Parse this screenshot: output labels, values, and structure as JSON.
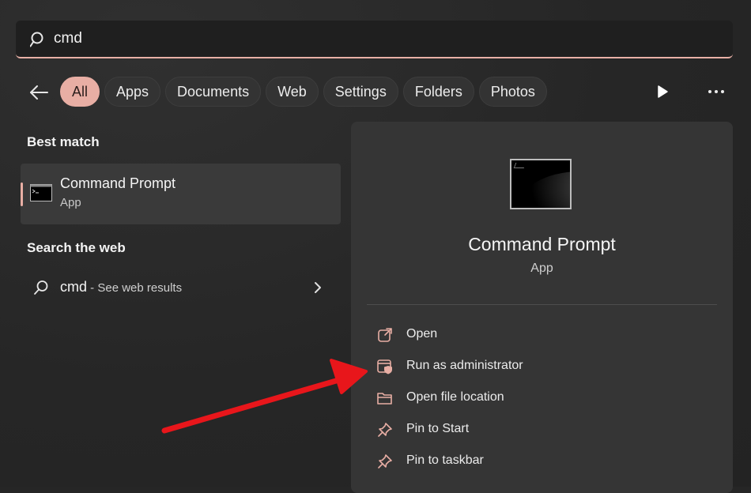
{
  "search": {
    "value": "cmd"
  },
  "filters": {
    "back_icon": "back-arrow-icon",
    "chips": [
      {
        "label": "All",
        "active": true
      },
      {
        "label": "Apps",
        "active": false
      },
      {
        "label": "Documents",
        "active": false
      },
      {
        "label": "Web",
        "active": false
      },
      {
        "label": "Settings",
        "active": false
      },
      {
        "label": "Folders",
        "active": false
      },
      {
        "label": "Photos",
        "active": false
      }
    ],
    "play_icon": "play-icon",
    "more_icon": "more-icon"
  },
  "left": {
    "best_match_title": "Best match",
    "best_match": {
      "name": "Command Prompt",
      "type": "App"
    },
    "web_title": "Search the web",
    "web_result": {
      "query": "cmd",
      "suffix": " - See web results"
    }
  },
  "details": {
    "name": "Command Prompt",
    "type": "App",
    "actions": [
      {
        "label": "Open",
        "icon": "open-external-icon"
      },
      {
        "label": "Run as administrator",
        "icon": "shield-admin-icon"
      },
      {
        "label": "Open file location",
        "icon": "folder-icon"
      },
      {
        "label": "Pin to Start",
        "icon": "pin-icon"
      },
      {
        "label": "Pin to taskbar",
        "icon": "pin-icon"
      }
    ]
  },
  "colors": {
    "accent": "#e8aea4",
    "background": "#262626",
    "panel": "#353535",
    "annotation_arrow": "#e8161b"
  }
}
